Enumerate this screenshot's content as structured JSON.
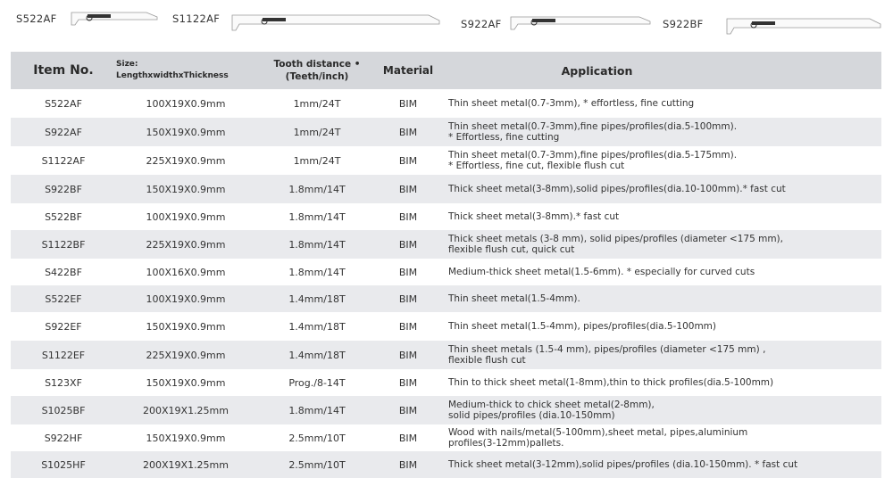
{
  "blades": [
    {
      "label": "S522AF"
    },
    {
      "label": "S1122AF"
    },
    {
      "label": "S922AF"
    },
    {
      "label": "S922BF"
    }
  ],
  "headers": {
    "item": "Item No.",
    "size_line1": "Size:",
    "size_line2": "LengthxwidthxThickness",
    "tooth_line1": "Tooth distance •",
    "tooth_line2": "(Teeth/inch)",
    "material": "Material",
    "application": "Application"
  },
  "rows": [
    {
      "item": "S522AF",
      "size": "100X19X0.9mm",
      "tooth": "1mm/24T",
      "material": "BIM",
      "app1": "Thin sheet metal(0.7-3mm), * effortless, fine cutting",
      "app2": ""
    },
    {
      "item": "S922AF",
      "size": "150X19X0.9mm",
      "tooth": "1mm/24T",
      "material": "BIM",
      "app1": "Thin sheet metal(0.7-3mm),fine pipes/profiles(dia.5-100mm).",
      "app2": "* Effortless, fine cutting"
    },
    {
      "item": "S1122AF",
      "size": "225X19X0.9mm",
      "tooth": "1mm/24T",
      "material": "BIM",
      "app1": "Thin sheet metal(0.7-3mm),fine pipes/profiles(dia.5-175mm).",
      "app2": "* Effortless, fine cut, flexible flush cut"
    },
    {
      "item": "S922BF",
      "size": "150X19X0.9mm",
      "tooth": "1.8mm/14T",
      "material": "BIM",
      "app1": "Thick sheet metal(3-8mm),solid pipes/profiles(dia.10-100mm).* fast cut",
      "app2": ""
    },
    {
      "item": "S522BF",
      "size": "100X19X0.9mm",
      "tooth": "1.8mm/14T",
      "material": "BIM",
      "app1": "Thick sheet metal(3-8mm).* fast cut",
      "app2": ""
    },
    {
      "item": "S1122BF",
      "size": "225X19X0.9mm",
      "tooth": "1.8mm/14T",
      "material": "BIM",
      "app1": "Thick sheet metals (3-8 mm), solid pipes/profiles (diameter <175 mm),",
      "app2": "flexible flush cut, quick cut"
    },
    {
      "item": "S422BF",
      "size": "100X16X0.9mm",
      "tooth": "1.8mm/14T",
      "material": "BIM",
      "app1": "Medium-thick sheet metal(1.5-6mm). * especially for curved cuts",
      "app2": ""
    },
    {
      "item": "S522EF",
      "size": "100X19X0.9mm",
      "tooth": "1.4mm/18T",
      "material": "BIM",
      "app1": "Thin sheet metal(1.5-4mm).",
      "app2": ""
    },
    {
      "item": "S922EF",
      "size": "150X19X0.9mm",
      "tooth": "1.4mm/18T",
      "material": "BIM",
      "app1": "Thin sheet metal(1.5-4mm), pipes/profiles(dia.5-100mm)",
      "app2": ""
    },
    {
      "item": "S1122EF",
      "size": "225X19X0.9mm",
      "tooth": "1.4mm/18T",
      "material": "BIM",
      "app1": "Thin sheet metals (1.5-4 mm), pipes/profiles (diameter <175 mm) ,",
      "app2": "flexible flush cut"
    },
    {
      "item": "S123XF",
      "size": "150X19X0.9mm",
      "tooth": "Prog./8-14T",
      "material": "BIM",
      "app1": "Thin to thick sheet metal(1-8mm),thin to thick profiles(dia.5-100mm)",
      "app2": ""
    },
    {
      "item": "S1025BF",
      "size": "200X19X1.25mm",
      "tooth": "1.8mm/14T",
      "material": "BIM",
      "app1": "Medium-thick to chick sheet metal(2-8mm),",
      "app2": "solid pipes/profiles (dia.10-150mm)"
    },
    {
      "item": "S922HF",
      "size": "150X19X0.9mm",
      "tooth": "2.5mm/10T",
      "material": "BIM",
      "app1": "Wood with nails/metal(5-100mm),sheet metal, pipes,aluminium",
      "app2": "profiles(3-12mm)pallets."
    },
    {
      "item": "S1025HF",
      "size": "200X19X1.25mm",
      "tooth": "2.5mm/10T",
      "material": "BIM",
      "app1": "Thick sheet metal(3-12mm),solid pipes/profiles (dia.10-150mm). * fast cut",
      "app2": ""
    }
  ]
}
